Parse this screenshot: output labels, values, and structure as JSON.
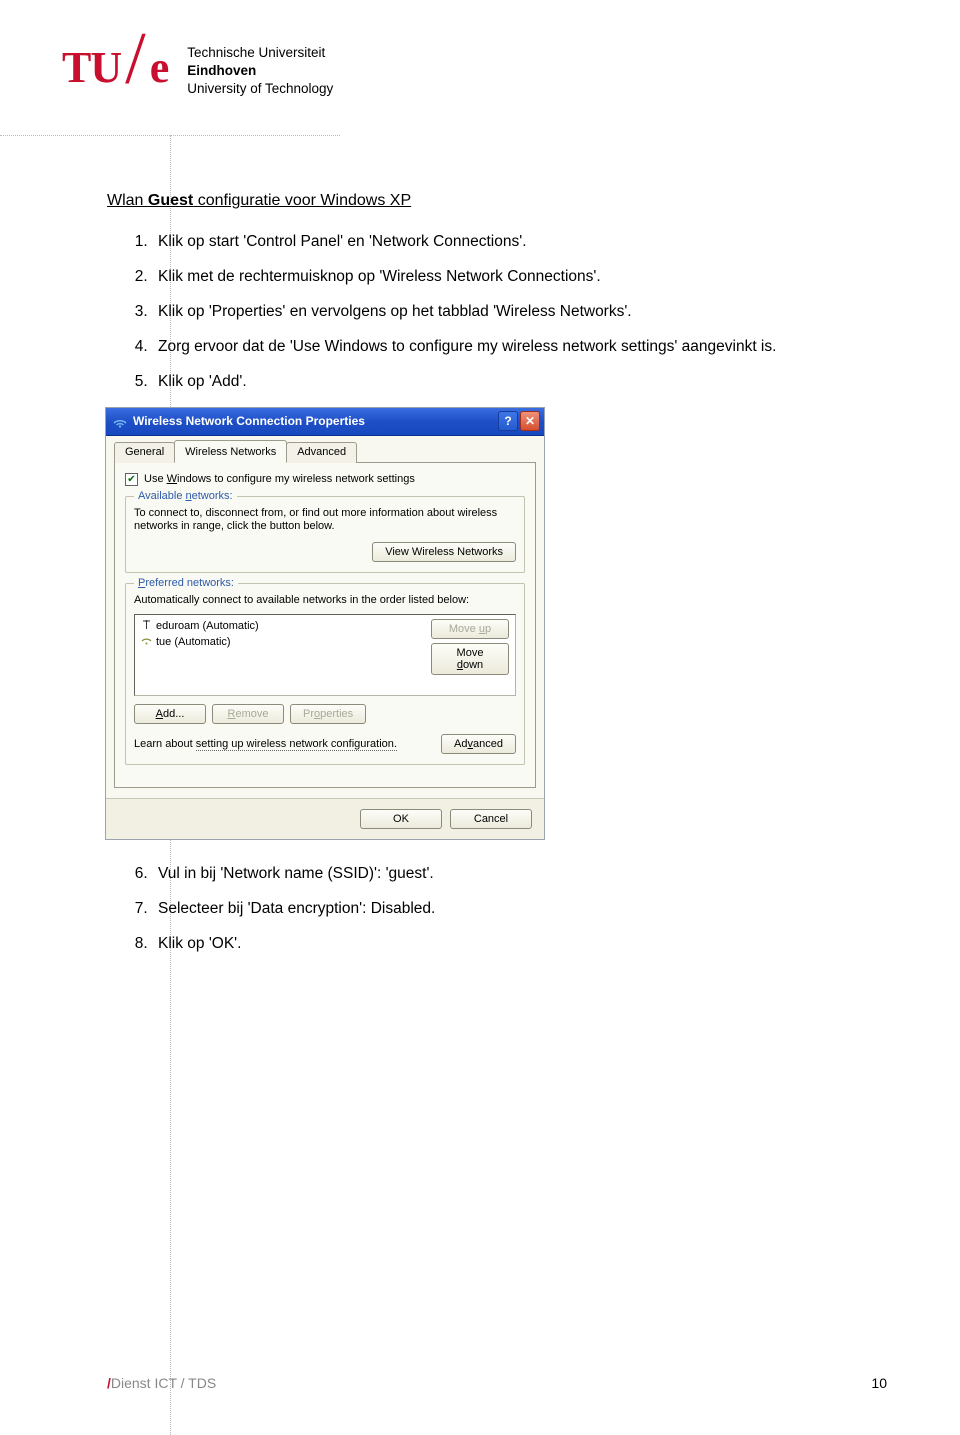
{
  "header": {
    "logo_tu": "TU",
    "logo_e": "e",
    "uni_line1": "Technische Universiteit",
    "uni_line2_bold": "Eindhoven",
    "uni_line3": "University of Technology"
  },
  "title": {
    "prefix": "Wlan ",
    "bold": "Guest",
    "suffix": " configuratie voor Windows XP"
  },
  "steps_before": [
    "Klik op start 'Control Panel' en 'Network Connections'.",
    "Klik met de rechtermuisknop op 'Wireless Network Connections'.",
    "Klik op 'Properties' en vervolgens op het tabblad 'Wireless Networks'.",
    "Zorg ervoor dat de 'Use Windows to configure my wireless network settings' aangevinkt is.",
    "Klik op 'Add'."
  ],
  "dialog": {
    "title": "Wireless Network Connection Properties",
    "tabs": {
      "general": "General",
      "wireless": "Wireless Networks",
      "advanced": "Advanced"
    },
    "checkbox_label": "Use Windows to configure my wireless network settings",
    "checkbox_underline": "W",
    "available_group_title": "Available networks:",
    "available_text": "To connect to, disconnect from, or find out more information about wireless networks in range, click the button below.",
    "view_button": "View Wireless Networks",
    "preferred_group_title": "Preferred networks:",
    "preferred_text": "Automatically connect to available networks in the order listed below:",
    "networks": [
      "eduroam (Automatic)",
      "tue (Automatic)"
    ],
    "move_up": "Move up",
    "move_down": "Move down",
    "add": "Add...",
    "remove": "Remove",
    "properties": "Properties",
    "learn_text_prefix": "Learn about ",
    "learn_link": "setting up wireless network configuration.",
    "advanced_btn": "Advanced",
    "ok": "OK",
    "cancel": "Cancel",
    "help_symbol": "?",
    "close_symbol": "✕"
  },
  "steps_after": [
    "Vul in bij 'Network name (SSID)': 'guest'.",
    "Selecteer bij 'Data encryption': Disabled.",
    "Klik op 'OK'."
  ],
  "footer": {
    "slash": "/",
    "dept": "Dienst ICT / TDS",
    "page": "10"
  }
}
